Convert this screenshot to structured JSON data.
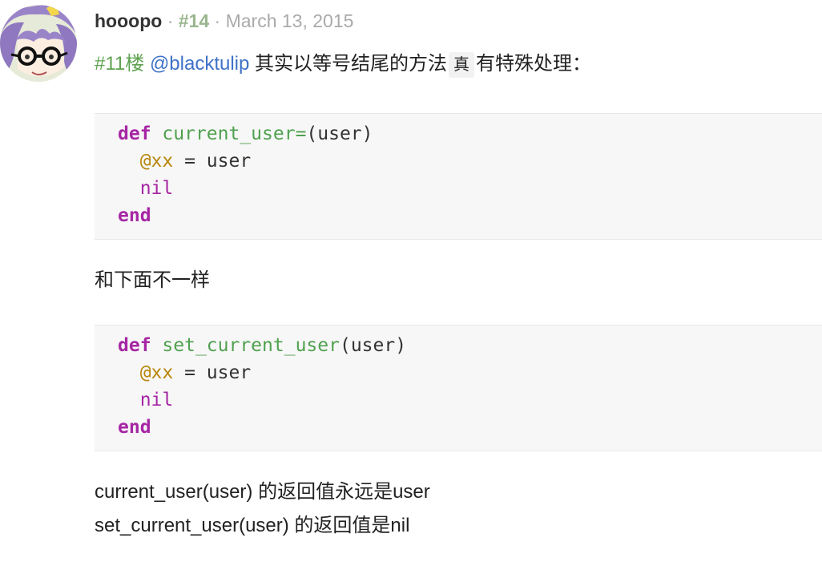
{
  "post": {
    "username": "hooopo",
    "separator": "·",
    "floor": "#14",
    "date": "March 13, 2015"
  },
  "intro": {
    "floor_ref": "#11楼",
    "mention": "@blacktulip",
    "text_before_code": "其实以等号结尾的方法",
    "inline_code": "真",
    "text_after_code": "有特殊处理："
  },
  "code_block_1": {
    "line1": {
      "kw": "def",
      "fn": "current_user=",
      "rest": "(user)"
    },
    "line2": {
      "ivar": "@xx",
      "rest": " = user"
    },
    "line3": {
      "nil": "nil"
    },
    "line4": {
      "kw": "end"
    }
  },
  "middle_text": "和下面不一样",
  "code_block_2": {
    "line1": {
      "kw": "def",
      "fn": "set_current_user",
      "rest": "(user)"
    },
    "line2": {
      "ivar": "@xx",
      "rest": " = user"
    },
    "line3": {
      "nil": "nil"
    },
    "line4": {
      "kw": "end"
    }
  },
  "conclusion": {
    "line1": "current_user(user) 的返回值永远是user",
    "line2": "set_current_user(user) 的返回值是nil"
  },
  "colors": {
    "floor_ref": "#5fa351",
    "mention": "#3f72c8",
    "keyword": "#a626a4",
    "function": "#50a14f",
    "instance_var": "#b8860b"
  }
}
